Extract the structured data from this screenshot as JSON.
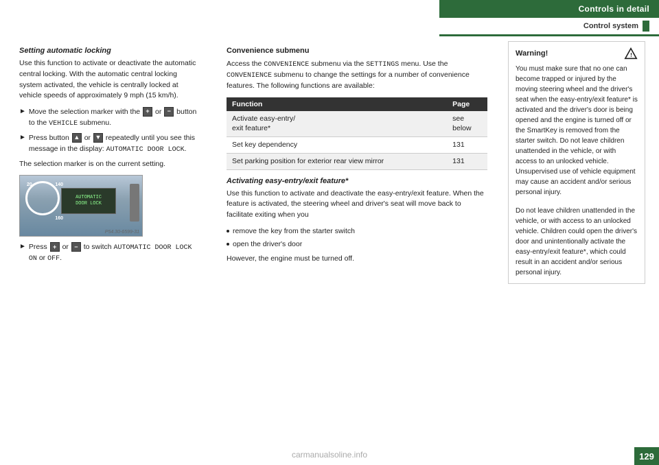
{
  "header": {
    "controls_in_detail": "Controls in detail",
    "control_system": "Control system"
  },
  "left_column": {
    "setting_heading": "Setting automatic locking",
    "setting_para1": "Use this function to activate or deactivate the automatic central locking. With the automatic central locking system activated, the vehicle is centrally locked at vehicle speeds of approximately 9 mph (15 km/h).",
    "bullet1_text": "Move the selection marker with the",
    "bullet1_middle": "or",
    "bullet1_end": "button to the",
    "bullet1_submenu": "VEHICLE",
    "bullet1_submenu2": "submenu.",
    "bullet2_text": "Press button",
    "bullet2_middle": "or",
    "bullet2_end": "repeatedly until you see this message in the display:",
    "bullet2_display": "AUTOMATIC DOOR LOCK",
    "bullet2_end2": ".",
    "selection_note": "The selection marker is on the current setting.",
    "lcd_line1": "AUTOMATIC",
    "lcd_line2": "DOOR LOCK",
    "image_caption": "P54.30-6599-31",
    "speedo_20": "20",
    "speedo_140": "140",
    "speedo_160": "160",
    "bullet3_text": "Press",
    "bullet3_or": "or",
    "bullet3_end": "to switch",
    "bullet3_label": "AUTOMATIC DOOR LOCK ON",
    "bullet3_or2": "or",
    "bullet3_off": "OFF",
    "bullet3_period": "."
  },
  "right_column": {
    "conv_heading": "Convenience submenu",
    "conv_para1": "Access the",
    "conv_mono1": "CONVENIENCE",
    "conv_para2": "submenu via the",
    "conv_mono2": "SETTINGS",
    "conv_para3": "menu. Use the",
    "conv_mono3": "CONVENIENCE",
    "conv_para4": "submenu to change the settings for a number of convenience features. The following functions are available:",
    "table": {
      "col1": "Function",
      "col2": "Page",
      "rows": [
        {
          "function": "Activate easy-entry/\nexit feature*",
          "page": "see\nbelow"
        },
        {
          "function": "Set key dependency",
          "page": "131"
        },
        {
          "function": "Set parking position for exterior rear view mirror",
          "page": "131"
        }
      ]
    },
    "activating_heading": "Activating easy-entry/exit feature*",
    "activating_para1": "Use this function to activate and deactivate the easy-entry/exit feature. When the feature is activated, the steering wheel and driver's seat will move back to facilitate exiting when you",
    "dot1": "remove the key from the starter switch",
    "dot2": "open the driver's door",
    "activating_para2": "However, the engine must be turned off."
  },
  "warning_box": {
    "title": "Warning!",
    "para1": "You must make sure that no one can become trapped or injured by the moving steering wheel and the driver's seat when the easy-entry/exit feature* is activated and the driver's door is being opened and the engine is turned off or the SmartKey is removed from the starter switch. Do not leave children unattended in the vehicle, or with access to an unlocked vehicle. Unsupervised use of vehicle equipment may cause an accident and/or serious personal injury.",
    "para2": "Do not leave children unattended in the vehicle, or with access to an unlocked vehicle. Children could open the driver's door and unintentionally activate the easy-entry/exit feature*, which could result in an accident and/or serious personal injury."
  },
  "page_number": "129",
  "watermark": "carmanualsoline.info"
}
